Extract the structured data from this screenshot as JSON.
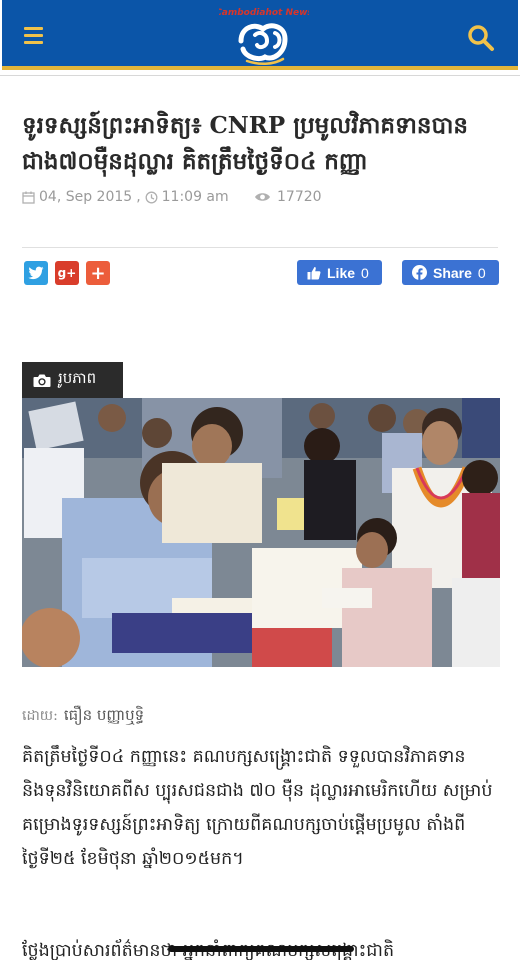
{
  "header": {
    "background_color": "#0b55a8",
    "accent_color": "#e2b53a",
    "logo_text": "Cambodiahot News"
  },
  "article": {
    "title": "ទូរទស្សន៍ព្រះអាទិត្យ៖ CNRP ប្រមូលវិភាគទានបាន ជាង៧០ម៉ឺនដុល្លារ គិតត្រឹមថ្ងៃទី០៤ កញ្ញា",
    "date": "04, Sep 2015",
    "time": "11:09 am",
    "views": "17720",
    "photo_label": "រូបភាព",
    "author_prefix": "ដោយ:",
    "author_name": "ធឿន បញ្ញាឬទ្ធិ",
    "paragraph1": "គិតត្រឹមថ្ងៃទី០៤ កញ្ញានេះ គណបក្សសង្គ្រោះជាតិ ទទួលបានវិភាគទាន និងទុនវិនិយោគពីស ប្បុរសជនជាង ៧០ ម៉ឺន ដុល្លារអាមេរិកហើយ សម្រាប់គម្រោងទូរទស្សន៍ព្រះអាទិត្យ ក្រោយពីគណបក្សចាប់ផ្តើមប្រមូល តាំងពីថ្ងៃទី២៥ ខែមិថុនា ឆ្នាំ២០១៥មក។",
    "paragraph2": "ថ្លែងប្រាប់សារព័ត៌មានថា អ្នកនាំពាក្យគណបក្សសង្គ្រោះជាតិ"
  },
  "share": {
    "like_label": "Like",
    "like_count": "0",
    "share_label": "Share",
    "share_count": "0",
    "twitter_icon": "twitter-icon",
    "gplus_label": "g+",
    "add_label": "+"
  }
}
